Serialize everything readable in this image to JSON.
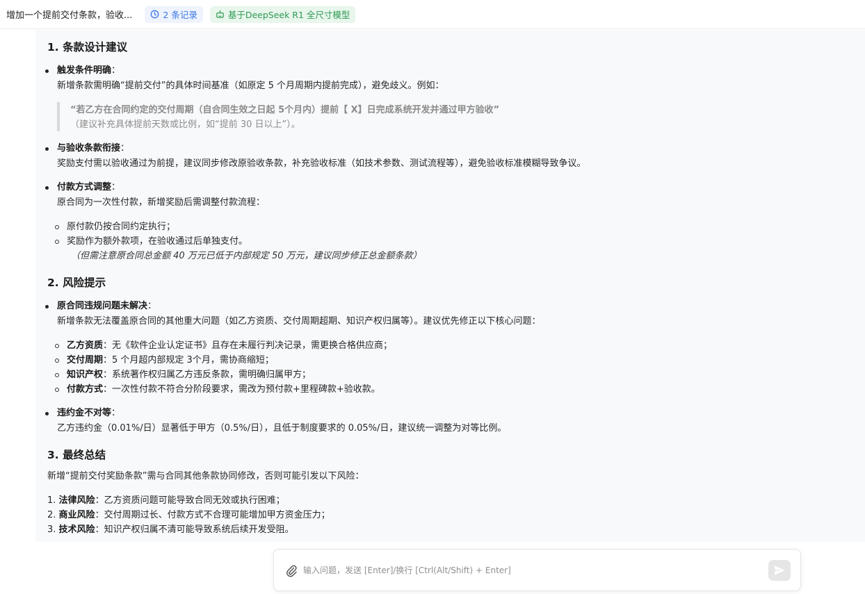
{
  "header": {
    "title": "增加一个提前交付条款，验收...",
    "records_label": "2 条记录",
    "model_label": "基于DeepSeek R1 全尺寸模型"
  },
  "sections": [
    {
      "heading": "1. 条款设计建议",
      "items": [
        {
          "label": "触发条件明确",
          "colon": "：",
          "text": "新增条款需明确“提前交付”的具体时间基准（如原定 5 个月周期内提前完成），避免歧义。例如：",
          "quote_main": "“若乙方在合同约定的交付周期（自合同生效之日起 5个月内）提前【 X】日完成系统开发并通过甲方验收”",
          "quote_note": "（建议补充具体提前天数或比例，如“提前 30 日以上”）。"
        },
        {
          "label": "与验收条款衔接",
          "colon": "：",
          "text": "奖励支付需以验收通过为前提，建议同步修改原验收条款，补充验收标准（如技术参数、测试流程等），避免验收标准模糊导致争议。"
        },
        {
          "label": "付款方式调整",
          "colon": "：",
          "text": "原合同为一次性付款，新增奖励后需调整付款流程：",
          "sub": [
            "原付款仍按合同约定执行；",
            "奖励作为额外款项，在验收通过后单独支付。"
          ],
          "note": "（但需注意原合同总金额 40 万元已低于内部规定 50 万元，建议同步修正总金额条款）"
        }
      ]
    },
    {
      "heading": "2. 风险提示",
      "items": [
        {
          "label": "原合同违规问题未解决",
          "colon": "：",
          "text": "新增条款无法覆盖原合同的其他重大问题（如乙方资质、交付周期超期、知识产权归属等）。建议优先修正以下核心问题：",
          "sub": [
            {
              "label": "乙方资质",
              "text": "：无《软件企业认定证书》且存在未履行判决记录，需更换合格供应商；"
            },
            {
              "label": "交付周期",
              "text": "：5 个月超内部规定 3个月，需协商缩短；"
            },
            {
              "label": "知识产权",
              "text": "：系统著作权归属乙方违反条款，需明确归属甲方；"
            },
            {
              "label": "付款方式",
              "text": "：一次性付款不符合分阶段要求，需改为预付款+里程碑款+验收款。"
            }
          ]
        },
        {
          "label": "违约金不对等",
          "colon": "：",
          "text": "乙方违约金（0.01%/日）显著低于甲方（0.5%/日），且低于制度要求的 0.05%/日，建议统一调整为对等比例。"
        }
      ]
    },
    {
      "heading": "3. 最终总结",
      "intro": "新增“提前交付奖励条款”需与合同其他条款协同修改，否则可能引发以下风险：",
      "ordered": [
        {
          "num": "1.",
          "label": "法律风险",
          "text": "：乙方资质问题可能导致合同无效或执行困难；"
        },
        {
          "num": "2.",
          "label": "商业风险",
          "text": "：交付周期过长、付款方式不合理可能增加甲方资金压力；"
        },
        {
          "num": "3.",
          "label": "技术风险",
          "text": "：知识产权归属不清可能导致系统后续开发受阻。"
        }
      ]
    }
  ],
  "input": {
    "placeholder": "输入问题，发送 [Enter]/换行 [Ctrl(Alt/Shift) + Enter]",
    "value": ""
  },
  "icons": {
    "records": "clock-icon",
    "model": "robot-icon",
    "attach": "paperclip-icon",
    "send": "send-icon"
  },
  "colors": {
    "records_badge_text": "#3d76e6",
    "model_badge_text": "#2f9a54",
    "chat_background": "#f8f9fb"
  }
}
